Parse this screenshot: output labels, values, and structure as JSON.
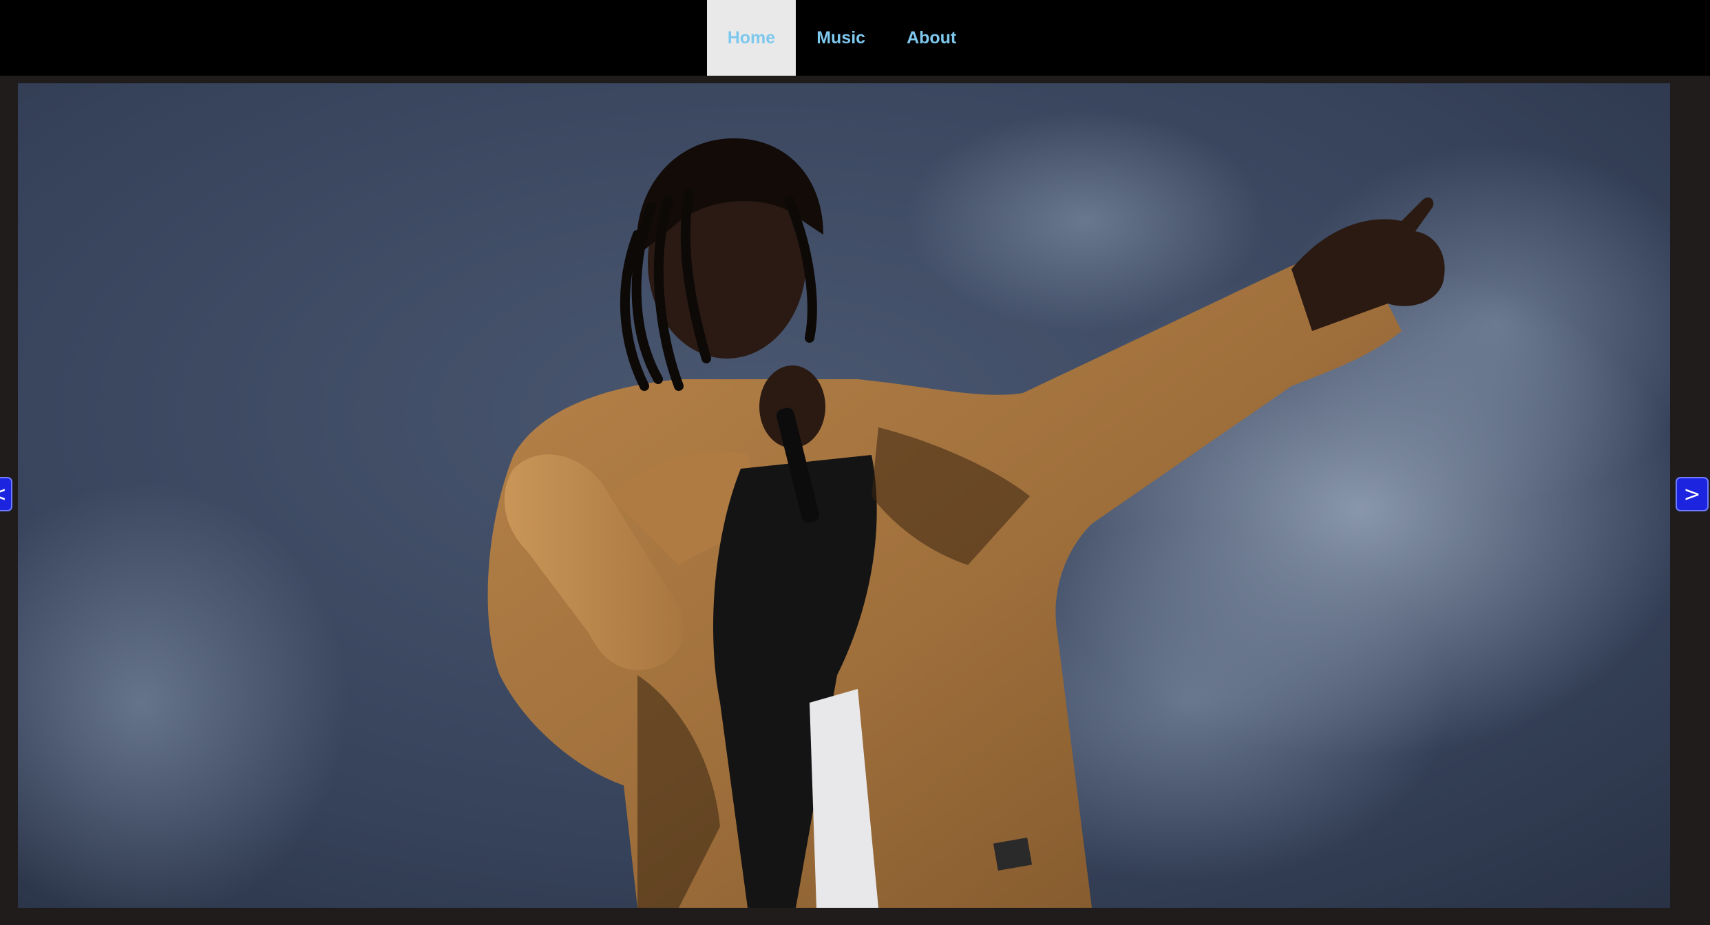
{
  "nav": {
    "items": [
      {
        "label": "Home",
        "active": true
      },
      {
        "label": "Music",
        "active": false
      },
      {
        "label": "About",
        "active": false
      }
    ]
  },
  "slideshow": {
    "prev_label": "<",
    "next_label": ">",
    "image_description": "performer in tan jacket holding microphone and pointing, smoky blue stage background"
  },
  "colors": {
    "nav_background": "#000000",
    "nav_link": "#7ec8ee",
    "nav_active_background": "#e9e9e9",
    "page_background": "#1f1c1b",
    "arrow_button": "#1c24e0"
  }
}
